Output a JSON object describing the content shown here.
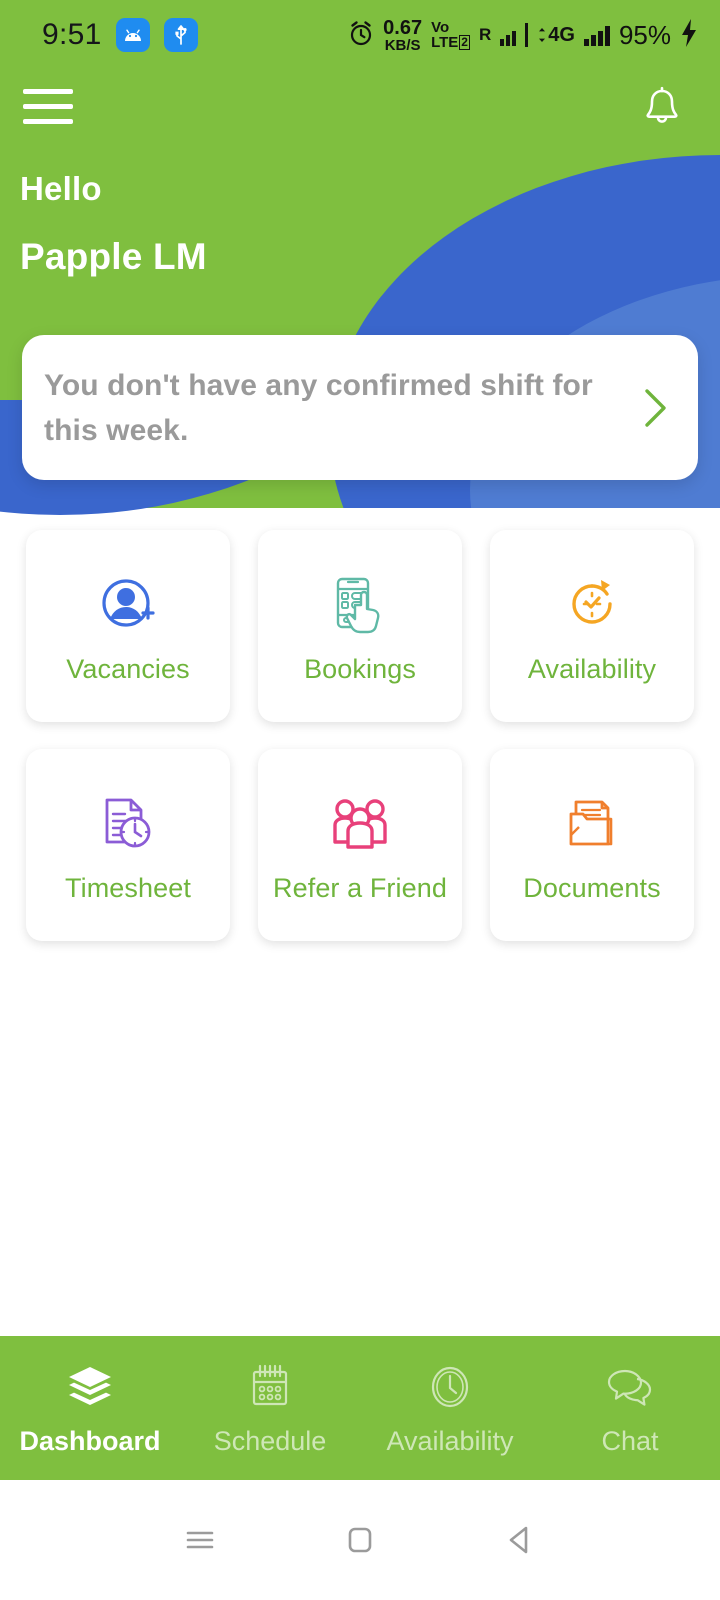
{
  "status_bar": {
    "time": "9:51",
    "left_icons": [
      "android-icon",
      "usb-icon"
    ],
    "alarm_icon": "alarm-icon",
    "net_speed_value": "0.67",
    "net_speed_unit": "KB/S",
    "volte_line1": "Vo",
    "volte_line2": "LTE",
    "volte_sim": "2",
    "roaming": "R",
    "network_type": "4G",
    "battery_percent": "95%",
    "charging_icon": "charging-bolt-icon"
  },
  "header": {
    "menu_icon": "hamburger-menu-icon",
    "bell_icon": "notification-bell-icon",
    "greeting": "Hello",
    "user_name": "Papple LM",
    "green": "#7FBF3F",
    "blue_dark": "#3A66CC",
    "blue_light": "#4F7CD2"
  },
  "info_card": {
    "message": "You don't have any confirmed shift for this week.",
    "chevron_icon": "chevron-right-icon",
    "chevron_color": "#6FB43C"
  },
  "tiles": [
    {
      "label": "Vacancies",
      "icon": "user-add-circle-icon",
      "color": "#3F6FE0"
    },
    {
      "label": "Bookings",
      "icon": "phone-tap-hand-icon",
      "color": "#5FB9A6"
    },
    {
      "label": "Availability",
      "icon": "clock-refresh-check-icon",
      "color": "#F5A623"
    },
    {
      "label": "Timesheet",
      "icon": "document-clock-icon",
      "color": "#8B5CD6"
    },
    {
      "label": "Refer a Friend",
      "icon": "people-group-icon",
      "color": "#E8407A"
    },
    {
      "label": "Documents",
      "icon": "folder-documents-icon",
      "color": "#F07F2D"
    }
  ],
  "tabs": [
    {
      "label": "Dashboard",
      "icon": "layers-icon",
      "active": true
    },
    {
      "label": "Schedule",
      "icon": "calendar-icon",
      "active": false
    },
    {
      "label": "Availability",
      "icon": "clock-icon",
      "active": false
    },
    {
      "label": "Chat",
      "icon": "chat-bubbles-icon",
      "active": false
    }
  ],
  "android_nav": {
    "recents_icon": "recents-icon",
    "home_icon": "home-square-icon",
    "back_icon": "back-triangle-icon"
  }
}
